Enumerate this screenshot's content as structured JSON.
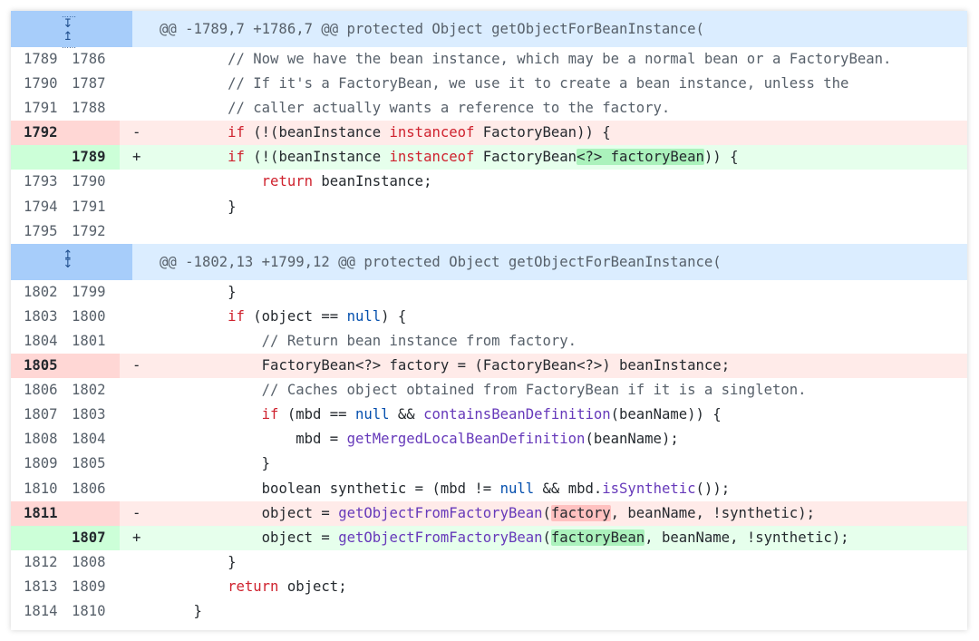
{
  "hunks": [
    {
      "header": "@@ -1789,7 +1786,7 @@ protected Object getObjectForBeanInstance(",
      "expand_icon": "expand-up-down-icon",
      "lines": [
        {
          "type": "ctx",
          "old": "1789",
          "new": "1786",
          "sign": "",
          "code": "        // Now we have the bean instance, which may be a normal bean or a FactoryBean."
        },
        {
          "type": "ctx",
          "old": "1790",
          "new": "1787",
          "sign": "",
          "code": "        // If it's a FactoryBean, we use it to create a bean instance, unless the"
        },
        {
          "type": "ctx",
          "old": "1791",
          "new": "1788",
          "sign": "",
          "code": "        // caller actually wants a reference to the factory."
        },
        {
          "type": "del",
          "old": "1792",
          "new": "",
          "sign": "-",
          "code": "        if (!(beanInstance instanceof FactoryBean)) {"
        },
        {
          "type": "add",
          "old": "",
          "new": "1789",
          "sign": "+",
          "code": "        if (!(beanInstance instanceof FactoryBean<?> factoryBean)) {"
        },
        {
          "type": "ctx",
          "old": "1793",
          "new": "1790",
          "sign": "",
          "code": "            return beanInstance;"
        },
        {
          "type": "ctx",
          "old": "1794",
          "new": "1791",
          "sign": "",
          "code": "        }"
        },
        {
          "type": "ctx",
          "old": "1795",
          "new": "1792",
          "sign": "",
          "code": ""
        }
      ]
    },
    {
      "header": "@@ -1802,13 +1799,12 @@ protected Object getObjectForBeanInstance(",
      "expand_icon": "expand-icon",
      "lines": [
        {
          "type": "ctx",
          "old": "1802",
          "new": "1799",
          "sign": "",
          "code": "        }"
        },
        {
          "type": "ctx",
          "old": "1803",
          "new": "1800",
          "sign": "",
          "code": "        if (object == null) {"
        },
        {
          "type": "ctx",
          "old": "1804",
          "new": "1801",
          "sign": "",
          "code": "            // Return bean instance from factory."
        },
        {
          "type": "del",
          "old": "1805",
          "new": "",
          "sign": "-",
          "code": "            FactoryBean<?> factory = (FactoryBean<?>) beanInstance;"
        },
        {
          "type": "ctx",
          "old": "1806",
          "new": "1802",
          "sign": "",
          "code": "            // Caches object obtained from FactoryBean if it is a singleton."
        },
        {
          "type": "ctx",
          "old": "1807",
          "new": "1803",
          "sign": "",
          "code": "            if (mbd == null && containsBeanDefinition(beanName)) {"
        },
        {
          "type": "ctx",
          "old": "1808",
          "new": "1804",
          "sign": "",
          "code": "                mbd = getMergedLocalBeanDefinition(beanName);"
        },
        {
          "type": "ctx",
          "old": "1809",
          "new": "1805",
          "sign": "",
          "code": "            }"
        },
        {
          "type": "ctx",
          "old": "1810",
          "new": "1806",
          "sign": "",
          "code": "            boolean synthetic = (mbd != null && mbd.isSynthetic());"
        },
        {
          "type": "del",
          "old": "1811",
          "new": "",
          "sign": "-",
          "code": "            object = getObjectFromFactoryBean(factory, beanName, !synthetic);"
        },
        {
          "type": "add",
          "old": "",
          "new": "1807",
          "sign": "+",
          "code": "            object = getObjectFromFactoryBean(factoryBean, beanName, !synthetic);"
        },
        {
          "type": "ctx",
          "old": "1812",
          "new": "1808",
          "sign": "",
          "code": "        }"
        },
        {
          "type": "ctx",
          "old": "1813",
          "new": "1809",
          "sign": "",
          "code": "        return object;"
        },
        {
          "type": "ctx",
          "old": "1814",
          "new": "1810",
          "sign": "",
          "code": "    }"
        }
      ]
    }
  ],
  "colors": {
    "hunk_gutter": "#a7cdfa",
    "hunk_bg": "#dbedff",
    "del_bg": "#ffebe9",
    "add_bg": "#e6ffec",
    "keyword": "#cf222e",
    "method": "#6639ba",
    "literal": "#0550ae"
  }
}
